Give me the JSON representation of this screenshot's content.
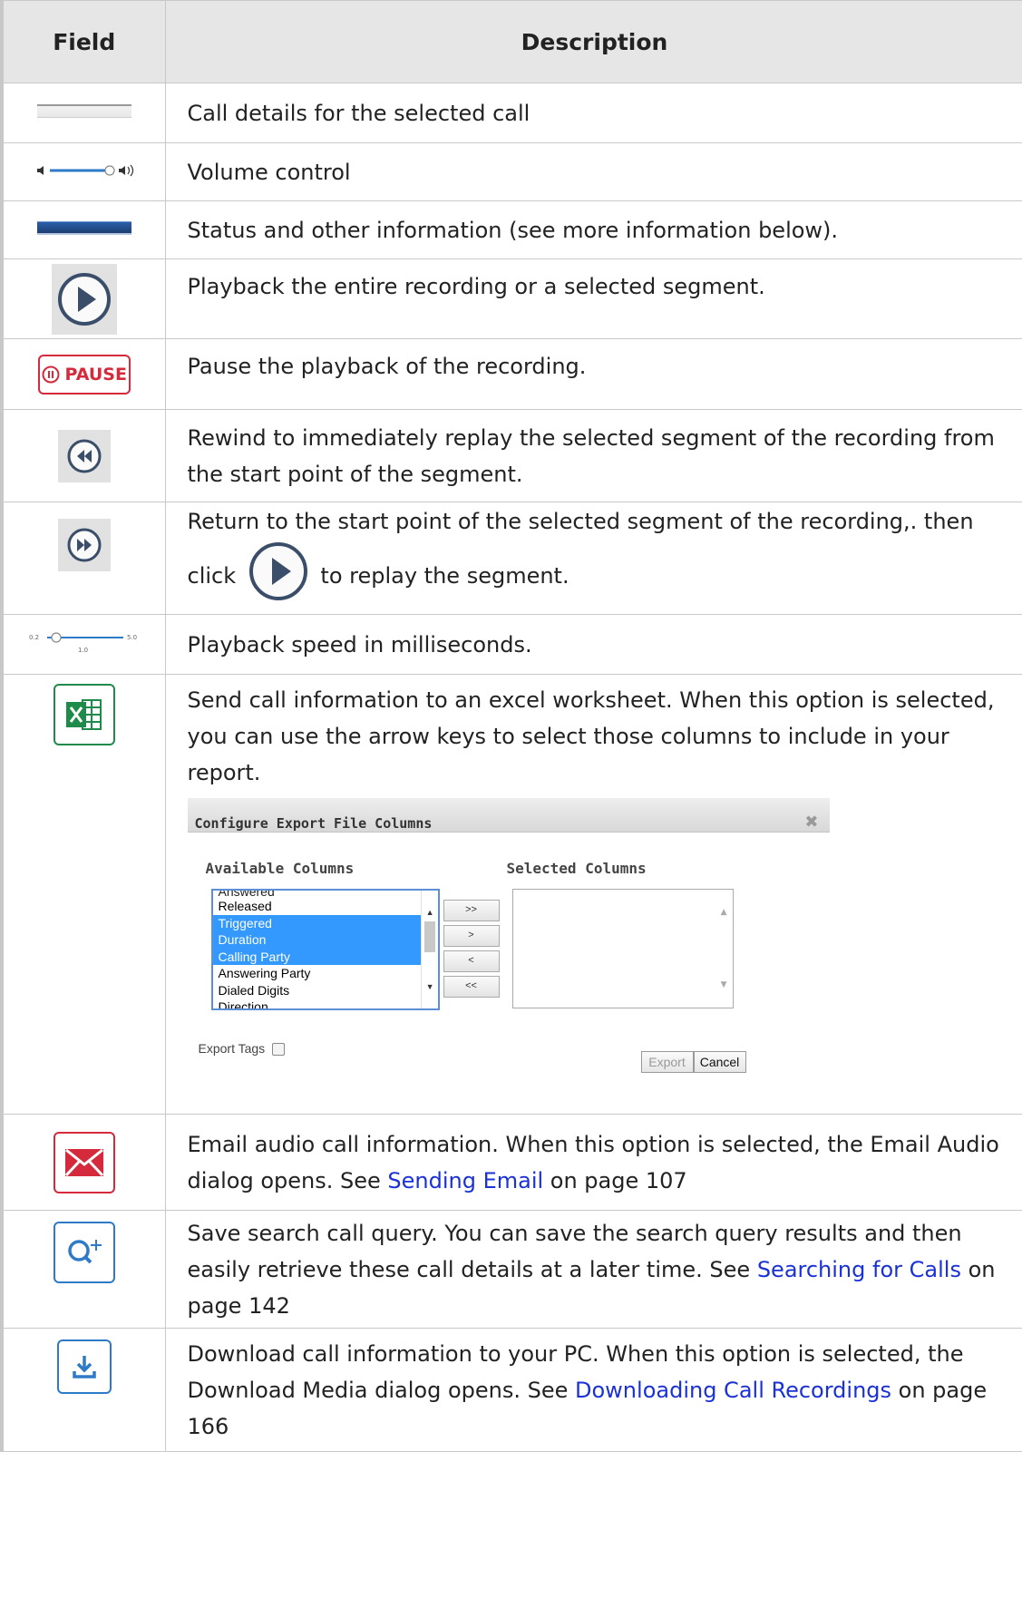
{
  "header": {
    "field": "Field",
    "description": "Description"
  },
  "rows": {
    "r1": {
      "text": "Call details for the selected call"
    },
    "r2": {
      "text": "Volume control"
    },
    "r3": {
      "text": "Status and other information (see more information below)."
    },
    "r4": {
      "text": "Playback the entire recording or a selected segment."
    },
    "r5": {
      "text": "Pause the playback of the recording.",
      "icon_label": "PAUSE"
    },
    "r6": {
      "text": "Rewind to immediately replay the selected segment of the recording from the start point of the segment."
    },
    "r7": {
      "text_before": "Return to the start point of the selected segment of the recording,. then click",
      "text_after": "to replay the segment."
    },
    "r8": {
      "text": "Playback speed in milliseconds.",
      "slider_min": "0.2",
      "slider_max": "5.0",
      "slider_value": "1.0"
    },
    "r9": {
      "text": "Send call information to an excel worksheet. When  this option is selected, you can use the arrow keys to select those columns to include in your report."
    },
    "r10": {
      "text": "Email audio call information. When this option is selected, the Email Audio dialog opens. See ",
      "link": "Sending Email",
      "after": " on page 107"
    },
    "r11": {
      "text": "Save search call query. You can save the search query results and then easily retrieve these call details at a later time. See ",
      "link": "Searching for Calls",
      "after": " on page 142"
    },
    "r12": {
      "text": "Download call information to your PC. When this option is selected, the Download Media dialog opens. See ",
      "link": "Downloading Call Recordings",
      "after": " on page 166"
    }
  },
  "export_dialog": {
    "title": "Configure Export File Columns",
    "available_label": "Available Columns",
    "selected_label": "Selected Columns",
    "available_items": [
      "Answered",
      "Released",
      "Triggered",
      "Duration",
      "Calling Party",
      "Answering Party",
      "Dialed Digits",
      "Direction"
    ],
    "selected_items_highlighted": [
      "Triggered",
      "Duration",
      "Calling Party"
    ],
    "move_buttons": [
      ">>",
      ">",
      "<",
      "<<"
    ],
    "export_tags_label": "Export Tags",
    "export_button": "Export",
    "cancel_button": "Cancel"
  },
  "colors": {
    "link": "#1a31d6",
    "excel_green": "#1e8b4b",
    "red": "#d42a3b",
    "blue": "#2d7ac7",
    "header_bg": "#e6e6e6"
  }
}
